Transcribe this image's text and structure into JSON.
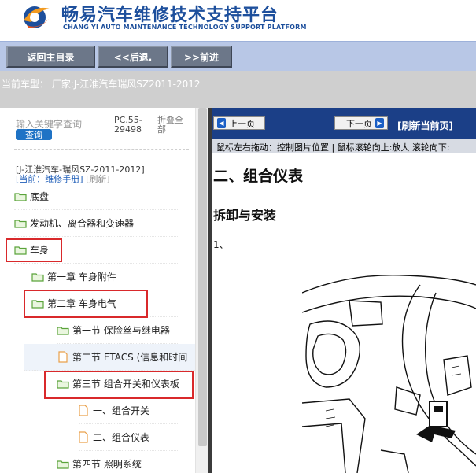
{
  "header": {
    "title_cn": "畅易汽车维修技术支持平台",
    "title_en": "CHANG YI AUTO MAINTENANCE TECHNOLOGY SUPPORT PLATFORM"
  },
  "toolbar": {
    "home_label": "返回主目录",
    "back_label": "<<后退.",
    "forward_label": ">>前进"
  },
  "vehicle": {
    "text": "当前车型： 厂家:J-江淮汽车瑞风SZ2011-2012"
  },
  "left": {
    "search_placeholder": "输入关键字查询",
    "search_button": "查询",
    "pc_code": "PC.55-29498",
    "collapse_all": "折叠全部",
    "crumb_path": "[J-江淮汽车-瑞风SZ-2011-2012]",
    "crumb_current": "[当前：维修手册]",
    "crumb_refresh": "[刷新]",
    "tree": [
      {
        "label": "底盘",
        "type": "folder"
      },
      {
        "label": "发动机、离合器和变速器",
        "type": "folder"
      },
      {
        "label": "车身",
        "type": "folder"
      },
      {
        "label": "第一章 车身附件",
        "type": "folder"
      },
      {
        "label": "第二章 车身电气",
        "type": "folder"
      },
      {
        "label": "第一节 保险丝与继电器",
        "type": "folder"
      },
      {
        "label": "第二节 ETACS (信息和时间",
        "type": "file"
      },
      {
        "label": "第三节 组合开关和仪表板",
        "type": "folder"
      },
      {
        "label": "一、组合开关",
        "type": "file"
      },
      {
        "label": "二、组合仪表",
        "type": "file"
      },
      {
        "label": "第四节 照明系统",
        "type": "folder"
      }
    ]
  },
  "right": {
    "prev_page": "上一页",
    "next_page": "下一页",
    "refresh_page": "[刷新当前页]",
    "hint": "鼠标左右拖动：控制图片位置 | 鼠标滚轮向上:放大  滚轮向下:",
    "doc_title": "二、组合仪表",
    "doc_subtitle": "拆卸与安装",
    "doc_step": "1、"
  },
  "colors": {
    "brand_blue": "#1d4f9c",
    "toolbar_bg": "#b8c7e6",
    "nav_blue": "#1b3f87",
    "highlight_red": "#d9292b",
    "folder_green": "#5aa33a"
  }
}
